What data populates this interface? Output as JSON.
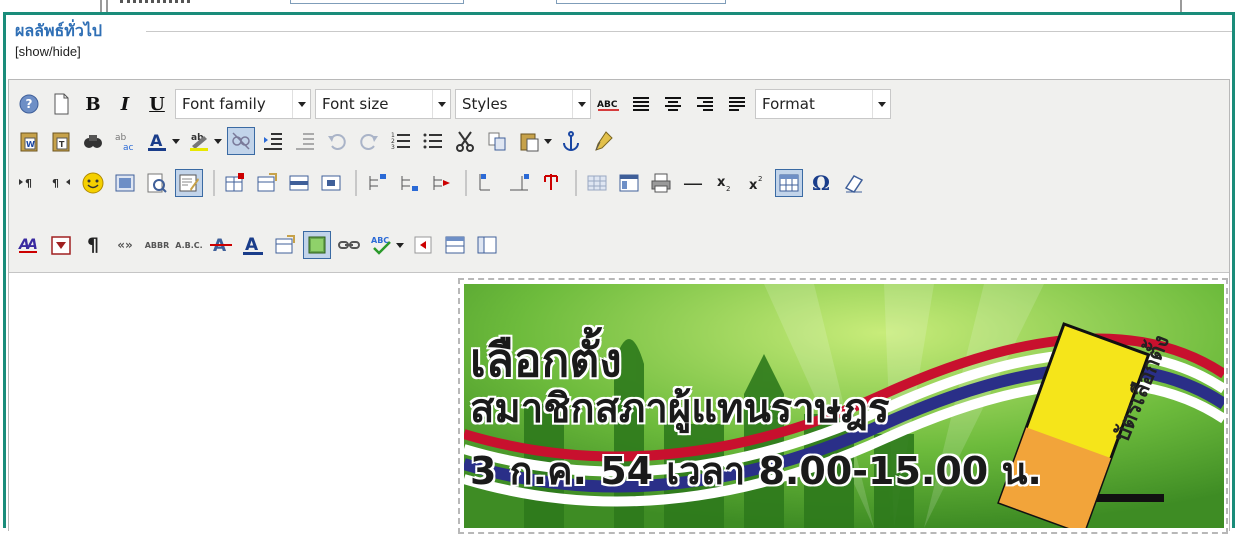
{
  "panel": {
    "legend": "ผลลัพธ์ทั่วไป",
    "toggle_link": "[show/hide]"
  },
  "toolbar": {
    "row1": {
      "icons": [
        "help-icon",
        "new-document-icon",
        "bold-icon",
        "italic-icon",
        "underline-icon"
      ],
      "bold_label": "B",
      "italic_label": "I",
      "underline_label": "U",
      "font_family": "Font family",
      "font_size": "Font size",
      "styles": "Styles",
      "format": "Format",
      "align_icons": [
        "spellcheck-icon",
        "align-left-icon",
        "align-center-icon",
        "align-right-icon",
        "align-justify-icon"
      ]
    },
    "row2": {
      "icons": [
        "paste-word-icon",
        "paste-text-icon",
        "find-icon",
        "replace-icon",
        "text-color-icon",
        "highlight-icon",
        "unlink-icon",
        "indent-icon",
        "outdent-icon",
        "undo-icon",
        "redo-icon",
        "ordered-list-icon",
        "unordered-list-icon",
        "cut-icon",
        "copy-icon",
        "paste-icon",
        "anchor-icon",
        "cleanup-icon"
      ]
    },
    "row3": {
      "icons": [
        "ltr-icon",
        "rtl-icon",
        "emoticon-icon",
        "media-icon",
        "preview-icon",
        "edit-html-icon",
        "table-insert-icon",
        "table-props-icon",
        "row-props-icon",
        "cell-props-icon",
        "col-before-icon",
        "col-after-icon",
        "col-delete-icon",
        "split-cells-icon",
        "merge-cells-icon",
        "delete-table-icon",
        "visual-aid-icon",
        "fullscreen-icon",
        "print-icon",
        "hr-icon",
        "subscript-icon",
        "superscript-icon",
        "charmap-table-icon",
        "special-char-icon",
        "remove-format-icon"
      ],
      "omega": "Ω",
      "hr": "—"
    },
    "row4": {
      "icons": [
        "style-props-icon",
        "insert-date-icon",
        "show-invisibles-icon",
        "cite-icon",
        "abbr-icon",
        "acronym-icon",
        "strikethrough-icon",
        "text-color-a-icon",
        "attributes-icon",
        "image-icon",
        "link-icon",
        "spellchecker-icon",
        "insert-layer-icon",
        "template-icon",
        "page-break-icon"
      ],
      "pilcrow": "¶",
      "cite": "«»",
      "abbr": "ABBR",
      "acronym": "A.B.C."
    }
  },
  "banner": {
    "line1": "เลือกตั้ง",
    "line2": "สมาชิกสภาผู้แทนราษฎร",
    "line3": "3 ก.ค. 54 เวลา 8.00-15.00 น.",
    "ballot": "บัตรเลือกตั้ง"
  },
  "colors": {
    "panel_border": "#1a8c7a",
    "legend": "#2f6fb5",
    "toolbar_bg": "#f0f0ee",
    "banner_green": "#5cae36"
  }
}
